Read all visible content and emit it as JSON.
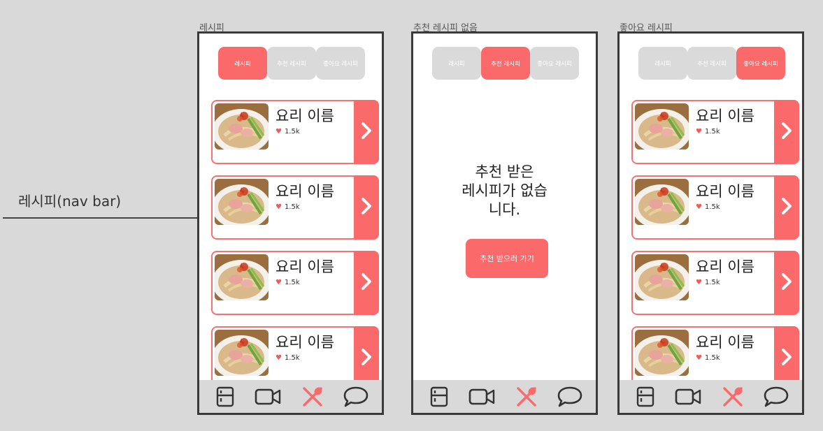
{
  "side_label": "레시피(nav bar)",
  "colors": {
    "accent": "#fb6a6b",
    "tab_inactive": "#dadada",
    "navbar_bg": "#d9d9d9"
  },
  "screens": [
    {
      "title": "레시피",
      "tabs": [
        "레시피",
        "추천 레시피",
        "좋아요 레시피"
      ],
      "active_tab": 0,
      "cards": [
        {
          "name": "요리 이름",
          "likes": "1.5k"
        },
        {
          "name": "요리 이름",
          "likes": "1.5k"
        },
        {
          "name": "요리 이름",
          "likes": "1.5k"
        },
        {
          "name": "요리 이름",
          "likes": "1.5k"
        }
      ]
    },
    {
      "title": "추천 레시피 없음",
      "tabs": [
        "레시피",
        "추천 레시피",
        "좋아요 레시피"
      ],
      "active_tab": 1,
      "empty_lines": [
        "추천 받은",
        "레시피가 없습",
        "니다."
      ],
      "button_label": "추천 받으러 가기"
    },
    {
      "title": "좋아요 레시피",
      "tabs": [
        "레시피",
        "추천 레시피",
        "좋아요 레시피"
      ],
      "active_tab": 2,
      "cards": [
        {
          "name": "요리 이름",
          "likes": "1.5k"
        },
        {
          "name": "요리 이름",
          "likes": "1.5k"
        },
        {
          "name": "요리 이름",
          "likes": "1.5k"
        },
        {
          "name": "요리 이름",
          "likes": "1.5k"
        }
      ]
    }
  ],
  "nav_icons": [
    "fridge-icon",
    "video-camera-icon",
    "spoon-fork-icon",
    "chat-bubble-icon"
  ],
  "active_nav": 2
}
